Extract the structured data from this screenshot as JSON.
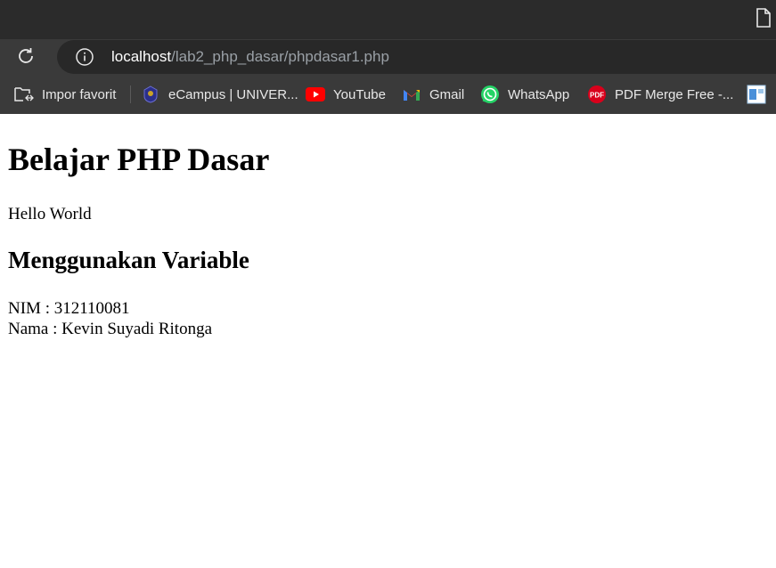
{
  "browser": {
    "url_host": "localhost",
    "url_path": "/lab2_php_dasar/phpdasar1.php",
    "bookmarks": [
      {
        "label": "Impor favorit",
        "icon": "import-favorites-icon"
      },
      {
        "label": "eCampus | UNIVER...",
        "icon": "ecampus-icon"
      },
      {
        "label": "YouTube",
        "icon": "youtube-icon"
      },
      {
        "label": "Gmail",
        "icon": "gmail-icon"
      },
      {
        "label": "WhatsApp",
        "icon": "whatsapp-icon"
      },
      {
        "label": "PDF Merge Free -...",
        "icon": "pdf-icon"
      }
    ]
  },
  "page": {
    "title": "Belajar PHP Dasar",
    "hello": "Hello World",
    "subtitle": "Menggunakan Variable",
    "nim": "NIM : 312110081",
    "nama": "Nama : Kevin Suyadi Ritonga"
  },
  "colors": {
    "toolbar": "#3a3a3a",
    "omnibox": "#282828",
    "youtube": "#ff0000",
    "whatsapp": "#25d366",
    "pdf": "#d9001b"
  }
}
